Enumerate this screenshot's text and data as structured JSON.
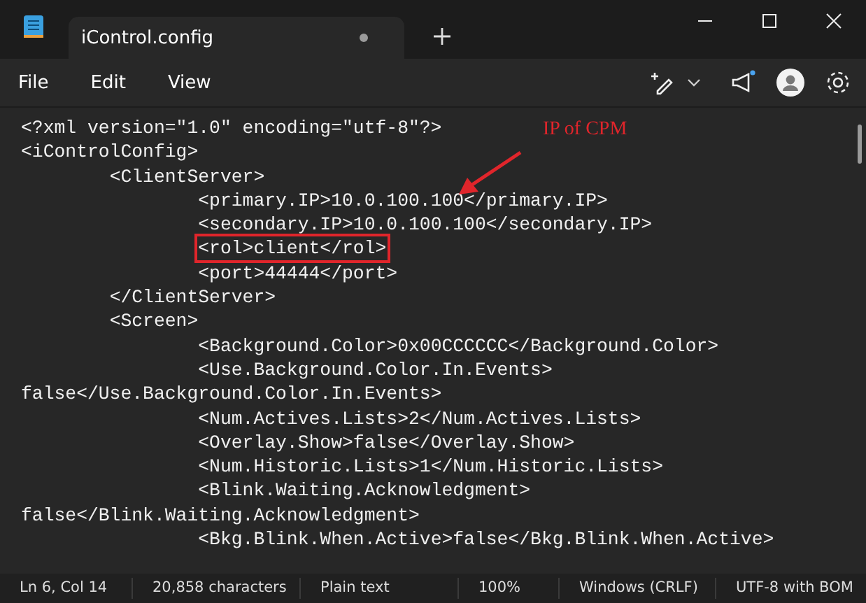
{
  "tabs": [
    {
      "label": "iControl.config",
      "selected": true,
      "unsaved": true
    }
  ],
  "menu": [
    "File",
    "Edit",
    "View"
  ],
  "editor": {
    "lines": [
      {
        "text": "<?xml version=\"1.0\" encoding=\"utf-8\"?>",
        "boxed": false
      },
      {
        "text": "<iControlConfig>",
        "boxed": false
      },
      {
        "text": "\t<ClientServer>",
        "boxed": false
      },
      {
        "text": "\t\t<primary.IP>10.0.100.100</primary.IP>",
        "boxed": false
      },
      {
        "text": "\t\t<secondary.IP>10.0.100.100</secondary.IP>",
        "boxed": false
      },
      {
        "text": "\t\t<rol>client</rol>",
        "boxed": true
      },
      {
        "text": "\t\t<port>44444</port>",
        "boxed": false
      },
      {
        "text": "\t</ClientServer>",
        "boxed": false
      },
      {
        "text": "\t<Screen>",
        "boxed": false
      },
      {
        "text": "\t\t<Background.Color>0x00CCCCCC</Background.Color>",
        "boxed": false
      },
      {
        "text": "\t\t<Use.Background.Color.In.Events>",
        "boxed": false
      },
      {
        "text": "false</Use.Background.Color.In.Events>",
        "boxed": false
      },
      {
        "text": "\t\t<Num.Actives.Lists>2</Num.Actives.Lists>",
        "boxed": false
      },
      {
        "text": "\t\t<Overlay.Show>false</Overlay.Show>",
        "boxed": false
      },
      {
        "text": "\t\t<Num.Historic.Lists>1</Num.Historic.Lists>",
        "boxed": false
      },
      {
        "text": "\t\t<Blink.Waiting.Acknowledgment>",
        "boxed": false
      },
      {
        "text": "false</Blink.Waiting.Acknowledgment>",
        "boxed": false
      },
      {
        "text": "\t\t<Bkg.Blink.When.Active>false</Bkg.Blink.When.Active>",
        "boxed": false
      }
    ],
    "annotation": "IP of CPM"
  },
  "status_bar": [
    "Ln 6, Col 14",
    "20,858 characters",
    "Plain text",
    "100%",
    "Windows (CRLF)",
    "UTF-8 with BOM"
  ]
}
